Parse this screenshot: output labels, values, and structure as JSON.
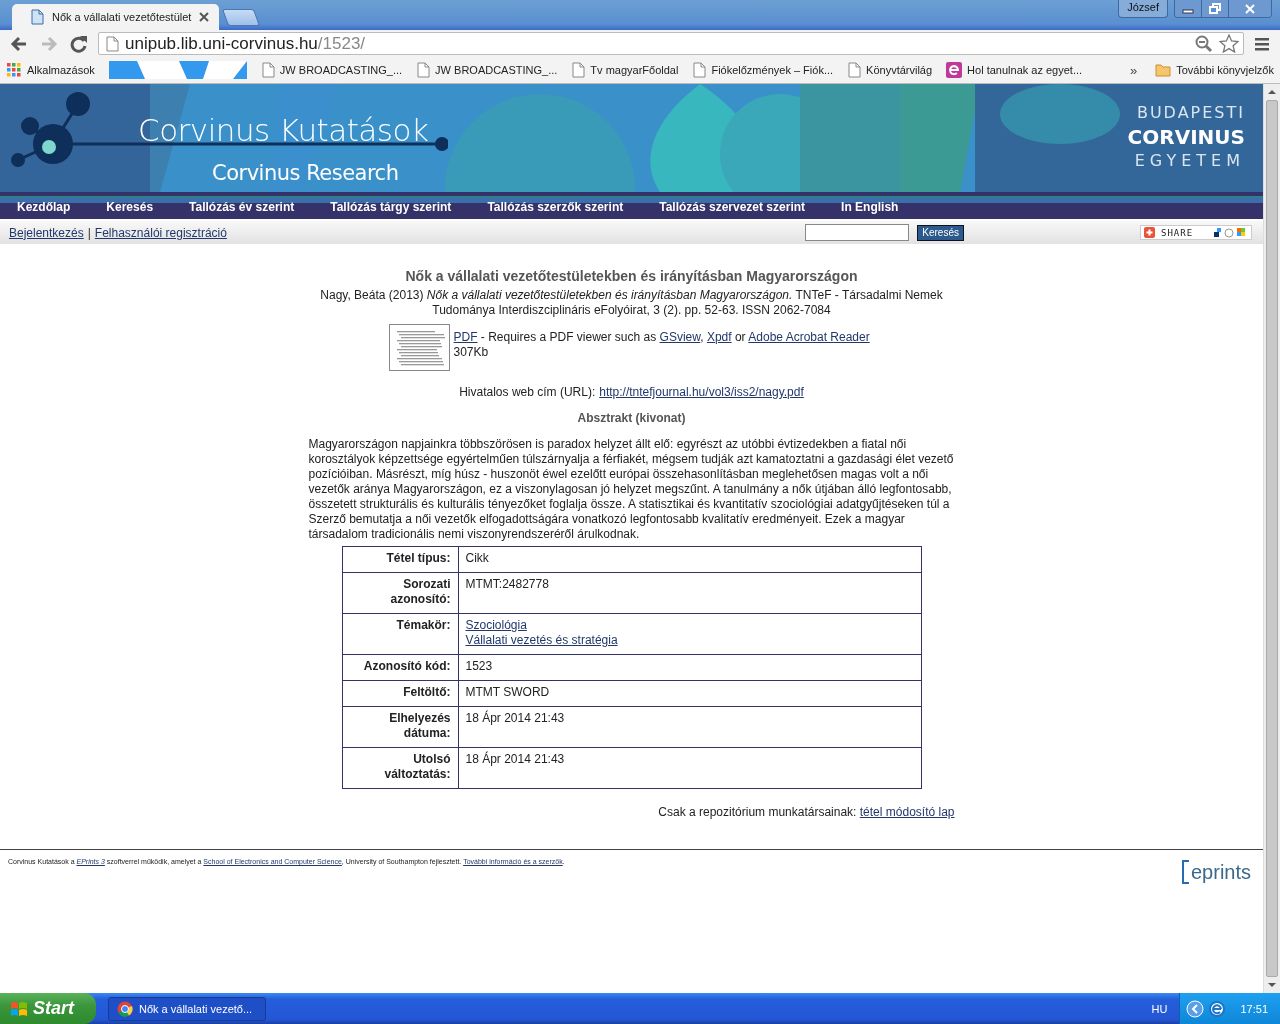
{
  "browser": {
    "tabs": [
      {
        "title": "Nők a vállalati vezetőtestület",
        "selected": true
      }
    ],
    "user": "József",
    "url_host": "unipub.lib.uni-corvinus.hu",
    "url_path": "/1523/",
    "bookmarks": [
      {
        "kind": "apps",
        "label": "Alkalmazások"
      },
      {
        "kind": "redacted"
      },
      {
        "kind": "page",
        "label": "JW BROADCASTING_..."
      },
      {
        "kind": "page",
        "label": "JW BROADCASTING_..."
      },
      {
        "kind": "page",
        "label": "Tv magyarFőoldal"
      },
      {
        "kind": "page",
        "label": "Fiókelőzmények – Fiók..."
      },
      {
        "kind": "page",
        "label": "Könyvtárvilág"
      },
      {
        "kind": "site",
        "label": "Hol tanulnak az egyet..."
      }
    ],
    "overflow": "»",
    "other_bookmarks": "További könyvjelzők"
  },
  "banner": {
    "title": "Corvinus Kutatások",
    "subtitle": "Corvinus Research",
    "university": [
      "BUDAPESTI",
      "CORVINUS",
      "EGYETEM"
    ]
  },
  "nav": [
    "Kezdőlap",
    "Keresés",
    "Tallózás év szerint",
    "Tallózás tárgy szerint",
    "Tallózás szerzők szerint",
    "Tallózás szervezet szerint",
    "In English"
  ],
  "login_links": [
    "Bejelentkezés",
    "Felhasználói regisztráció"
  ],
  "login_separator": "|",
  "search_button": "Keresés",
  "share": "SHARE",
  "item": {
    "title": "Nők a vállalati vezetőtestületekben és irányításban Magyarországon",
    "citation": "Nagy, Beáta (2013) *Nők a vállalati vezetőtestületekben és irányításban Magyarországon.* TNTeF - Társadalmi Nemek Tudománya Interdiszciplináris eFolyóirat, 3 (2). pp. 52-63. ISSN 2062-7084",
    "document": [
      {
        "text": "PDF",
        "link": true
      },
      {
        "text": " - Requires a PDF viewer such as ",
        "link": false
      },
      {
        "text": "GSview",
        "link": true
      },
      {
        "text": ", ",
        "link": false
      },
      {
        "text": "Xpdf",
        "link": true
      },
      {
        "text": " or ",
        "link": false
      },
      {
        "text": "Adobe Acrobat Reader",
        "link": true
      }
    ],
    "size": "307Kb",
    "url_label": "Hivatalos web cím (URL):",
    "url": "http://tntefjournal.hu/vol3/iss2/nagy.pdf",
    "abstract_heading": "Absztrakt (kivonat)",
    "abstract": "Magyarországon napjainkra többszörösen is paradox helyzet állt elő: egyrészt az utóbbi évtizedekben a fiatal női korosztályok képzettsége egyértelműen túlszárnyalja a férfiakét, mégsem tudják azt kamatoztatni a gazdasági élet vezető pozícióiban. Másrészt, míg húsz - huszonöt éwel ezelőtt európai összehasonlításban meglehetősen magas volt a női vezetők aránya Magyarországon, ez a viszonylagosan jó helyzet megszűnt. A tanulmány a nők útjában álló legfontosabb, összetett strukturális és kulturális tényezőket foglalja össze. A statisztikai és kvantitatív szociológiai adatgyűjtéseken túl a Szerző bemutatja a női vezetők elfogadottságára vonatkozó legfontosabb kvalitatív eredményeit. Ezek a magyar társadalom tradicionális nemi viszonyrendszeréről árulkodnak.",
    "details": [
      {
        "label": "Tétel típus:",
        "values": [
          {
            "text": "Cikk",
            "link": false
          }
        ]
      },
      {
        "label": "Sorozati azonosító:",
        "values": [
          {
            "text": "MTMT:2482778",
            "link": false
          }
        ]
      },
      {
        "label": "Témakör:",
        "values": [
          {
            "text": "Szociológia",
            "link": true
          },
          {
            "text": "Vállalati vezetés és stratégia",
            "link": true
          }
        ]
      },
      {
        "label": "Azonosító kód:",
        "values": [
          {
            "text": "1523",
            "link": false
          }
        ]
      },
      {
        "label": "Feltöltő:",
        "values": [
          {
            "text": "MTMT SWORD",
            "link": false
          }
        ]
      },
      {
        "label": "Elhelyezés dátuma:",
        "values": [
          {
            "text": "18 Ápr 2014 21:43",
            "link": false
          }
        ]
      },
      {
        "label": "Utolsó változtatás:",
        "values": [
          {
            "text": "18 Ápr 2014 21:43",
            "link": false
          }
        ]
      }
    ],
    "staff_label": "Csak a repozitórium munkatársainak:",
    "staff_link": "tétel módosító lap"
  },
  "footer": [
    {
      "text": "Corvinus Kutatások a ",
      "link": false
    },
    {
      "text": "EPrints 3",
      "link": true,
      "italic": true
    },
    {
      "text": " szoftverrel működik, amelyet a ",
      "link": false
    },
    {
      "text": "School of Electronics and Computer Science",
      "link": true
    },
    {
      "text": ", University of Southampton fejlesztett. ",
      "link": false
    },
    {
      "text": "További információ és a szerzők",
      "link": true
    },
    {
      "text": ".",
      "link": false
    }
  ],
  "footer_logo": "eprints",
  "taskbar": {
    "start": "Start",
    "task": "Nők a vállalati vezető...",
    "language": "HU",
    "time": "17:51"
  }
}
